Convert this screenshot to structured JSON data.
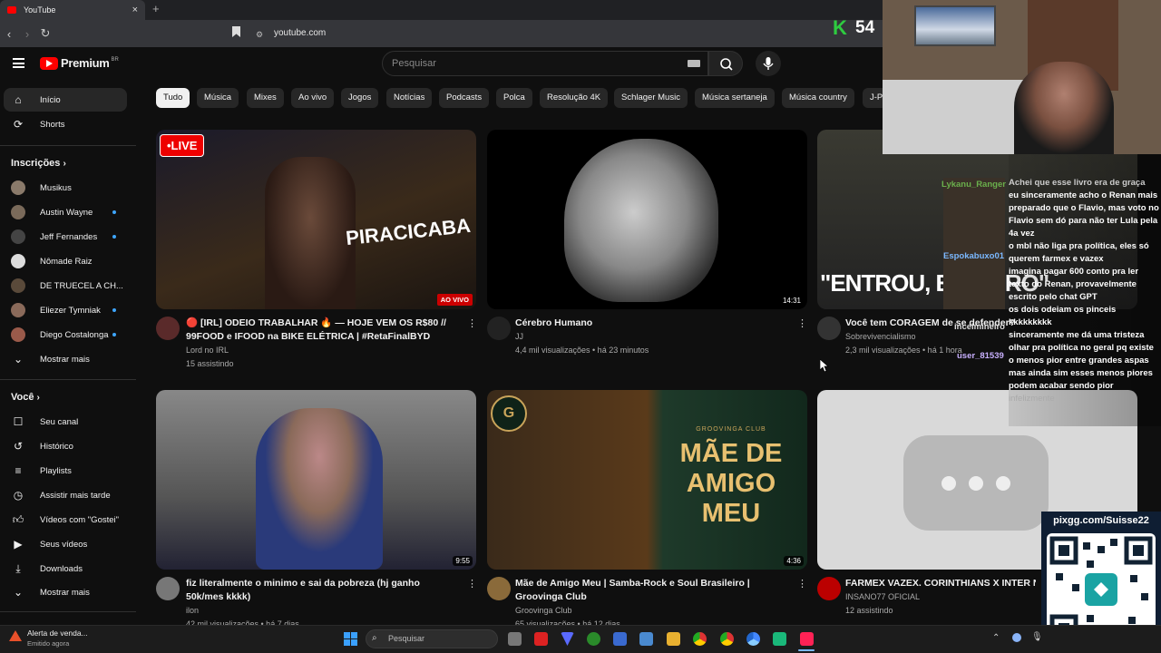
{
  "browser": {
    "tab_title": "YouTube",
    "tab_close": "×",
    "new_tab": "+",
    "url": "youtube.com"
  },
  "header": {
    "logo_text": "Premium",
    "logo_country": "BR",
    "search_placeholder": "Pesquisar"
  },
  "chips": [
    "Tudo",
    "Música",
    "Mixes",
    "Ao vivo",
    "Jogos",
    "Notícias",
    "Podcasts",
    "Polca",
    "Resolução 4K",
    "Schlager Music",
    "Música sertaneja",
    "Música country",
    "J-Po"
  ],
  "sidebar": {
    "main": [
      {
        "label": "Início",
        "icon": "home-icon"
      },
      {
        "label": "Shorts",
        "icon": "shorts-icon"
      }
    ],
    "subs_title": "Inscrições",
    "subs": [
      {
        "label": "Musikus",
        "color": "#8a7a6a"
      },
      {
        "label": "Austin Wayne",
        "color": "#7a6a5a"
      },
      {
        "label": "Jeff Fernandes",
        "color": "#444444"
      },
      {
        "label": "Nômade Raiz",
        "color": "#dddddd"
      },
      {
        "label": "DE TRUECEL A CH...",
        "color": "#5a4a3a"
      },
      {
        "label": "Eliezer Tymniak",
        "color": "#8a6a5a"
      },
      {
        "label": "Diego Costalonga",
        "color": "#9a5a4a"
      }
    ],
    "more_subs": "Mostrar mais",
    "you_title": "Você",
    "you": [
      {
        "label": "Seu canal",
        "icon": "channel-icon"
      },
      {
        "label": "Histórico",
        "icon": "history-icon"
      },
      {
        "label": "Playlists",
        "icon": "playlists-icon"
      },
      {
        "label": "Assistir mais tarde",
        "icon": "clock-icon"
      },
      {
        "label": "Vídeos com \"Gostei\"",
        "icon": "like-icon"
      },
      {
        "label": "Seus vídeos",
        "icon": "video-icon"
      },
      {
        "label": "Downloads",
        "icon": "download-icon"
      }
    ],
    "more_you": "Mostrar mais"
  },
  "videos": [
    {
      "title": "🔴 [IRL] ODEIO TRABALHAR 🔥 — HOJE VEM OS R$80 // 99FOOD e IFOOD na BIKE ELÉTRICA | #RetaFinalBYD",
      "channel": "Lord no IRL",
      "meta": "15 assistindo",
      "badge": "AO VIVO",
      "live_label": "•LIVE",
      "thumb_text": "PIRACICABA"
    },
    {
      "title": "Cérebro Humano",
      "channel": "JJ",
      "meta": "4,4 mil visualizações • há 23 minutos",
      "duration": "14:31"
    },
    {
      "title": "Você tem CORAGEM  de se defender?",
      "channel": "Sobrevivencialismo",
      "meta": "2,3 mil visualizações • há 1 hora",
      "thumb_text": "\"ENTROU, EU ATIRO\""
    },
    {
      "title": "fiz literalmente o minimo e sai da pobreza (hj ganho 50k/mes kkkk)",
      "channel": "ilon",
      "meta": "42 mil visualizações • há 7 dias",
      "duration": "9:55"
    },
    {
      "title": "Mãe de Amigo Meu | Samba-Rock e Soul Brasileiro | Groovinga Club",
      "channel": "Groovinga Club",
      "meta": "65 visualizações • há 12 dias",
      "duration": "4:36",
      "thumb_text": "MÃE DE AMIGO MEU",
      "thumb_small": "GROOVINGA CLUB"
    },
    {
      "title": "FARMEX VAZEX. CORINTHIANS X INTER NA",
      "channel": "INSANO77 OFICIAL",
      "meta": "12 assistindo"
    }
  ],
  "overlay": {
    "counter": "54",
    "qr_label": "pixgg.com/Suisse22",
    "chat": [
      "Achei que esse livro era de graça",
      "eu sinceramente acho o Renan mais preparado que o Flavio, mas voto no Flavio sem dó para não ter Lula pela 4a vez",
      "o mbl não liga pra política, eles só querem farmex e vazex",
      "imagina pagar 600 conto pra ler texto do Renan, provavelmente escrito pelo chat GPT",
      "os dois odeiam os pinceis",
      "kkkkkkkkk",
      "sinceramente me dá uma tristeza olhar pra política no geral pq existe o menos pior entre grandes aspas mas ainda sim esses menos piores podem acabar sendo pior",
      "infelizmente"
    ],
    "chat_names": [
      "Lykanu_Ranger",
      "Espokabuxo01",
      "incelmineiro",
      "user_81539"
    ]
  },
  "taskbar": {
    "notif_title": "Alerta de venda...",
    "notif_sub": "Emitido agora",
    "search_placeholder": "Pesquisar"
  }
}
